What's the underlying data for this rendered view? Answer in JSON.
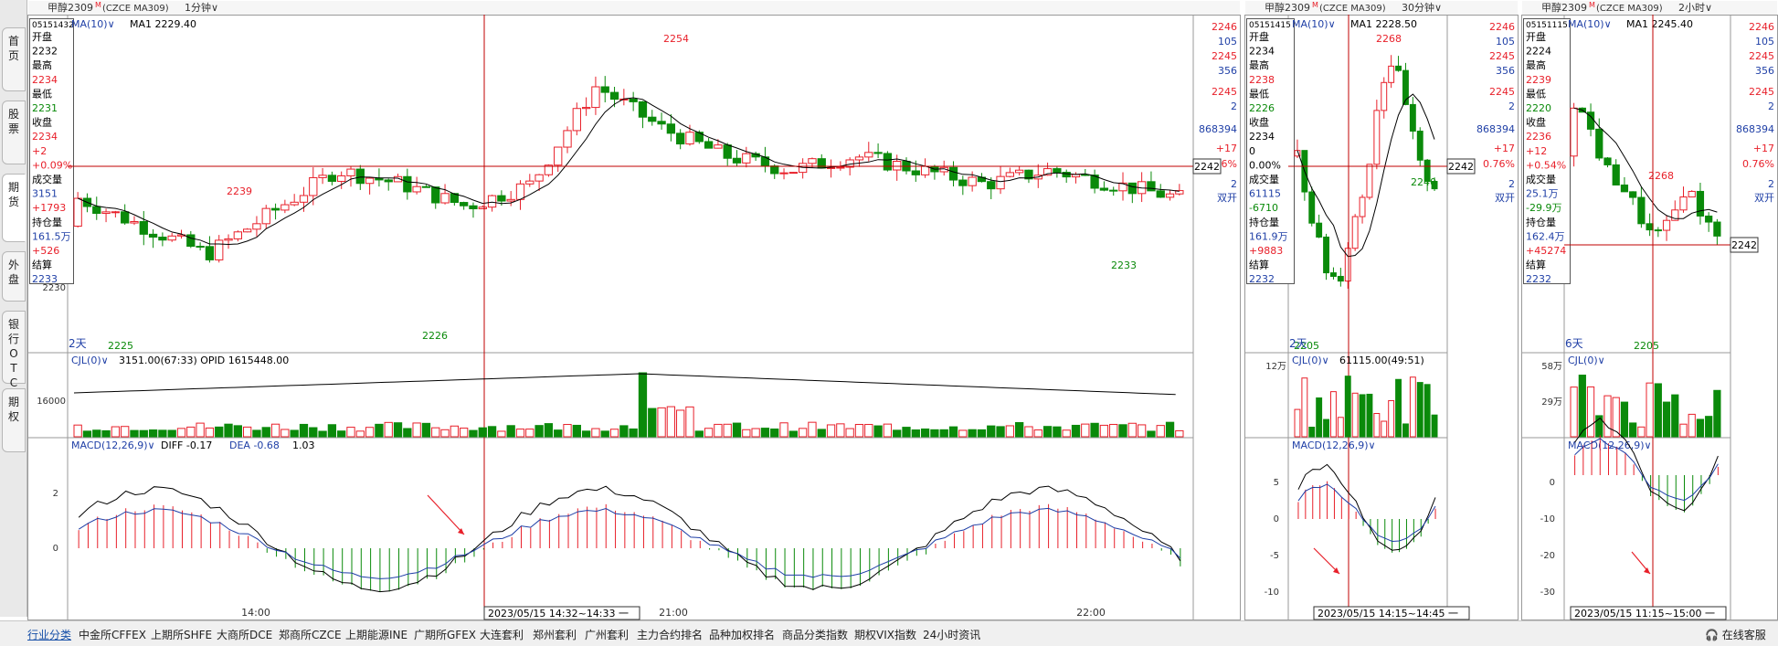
{
  "left_tabs": [
    "首页",
    "股票",
    "期货",
    "外盘",
    "银行OTC",
    "期权"
  ],
  "bottom_tabs": [
    "行业分类",
    "中金所CFFEX",
    "上期所SHFE",
    "大商所DCE",
    "郑商所CZCE",
    "上期能源INE",
    "广期所GFEX",
    "大连套利",
    "郑州套利",
    "广州套利",
    "主力合约排名",
    "品种加权排名",
    "商品分类指数",
    "期权VIX指数",
    "24小时资讯"
  ],
  "online_service": "在线客服",
  "colors": {
    "up": "#e8202a",
    "down": "#0a8a0a",
    "blue": "#1f3fa6",
    "crosshair": "#c00000"
  },
  "panels": [
    {
      "name": "min1",
      "header": {
        "title": "甲醇2309",
        "sup": "M",
        "code": "(CZCE MA309)",
        "period": "1分钟"
      },
      "ma_label": "MA(10)",
      "ma_value": "MA1 2229.40",
      "info": {
        "id": "05151432",
        "rows": [
          [
            "开盘",
            "k"
          ],
          [
            "2232",
            "v"
          ],
          [
            "最高",
            "k"
          ],
          [
            "2234",
            "r"
          ],
          [
            "最低",
            "k"
          ],
          [
            "2231",
            "g"
          ],
          [
            "收盘",
            "k"
          ],
          [
            "2234",
            "r"
          ],
          [
            "+2",
            "r"
          ],
          [
            "+0.09%",
            "r"
          ],
          [
            "成交量",
            "k"
          ],
          [
            "3151",
            "b"
          ],
          [
            "+1793",
            "r"
          ],
          [
            "持仓量",
            "k"
          ],
          [
            "161.5万",
            "b"
          ],
          [
            "+526",
            "r"
          ],
          [
            "结算",
            "k"
          ],
          [
            "2233",
            "b"
          ]
        ]
      },
      "price_axis_label": "2230",
      "days_label": "2天",
      "annotations": [
        {
          "text": "2254",
          "color": "red"
        },
        {
          "text": "2239",
          "color": "red"
        },
        {
          "text": "2225",
          "color": "green"
        },
        {
          "text": "2226",
          "color": "green"
        },
        {
          "text": "2233",
          "color": "green"
        }
      ],
      "cross_price": "2242",
      "vol_label": "CJL(0)",
      "vol_value": "3151.00(67:33)  OPID 1615448.00",
      "vol_axis": [
        "16000"
      ],
      "macd_label": "MACD(12,26,9)",
      "macd_diff": "DIFF -0.17",
      "macd_dea": "DEA -0.68",
      "macd_val": "1.03",
      "macd_axis": [
        "2",
        "0"
      ],
      "time_labels": [
        "14:00",
        "21:00",
        "22:00"
      ],
      "time_box": "2023/05/15 14:32~14:33 一",
      "right_stats": [
        [
          "2246",
          "r"
        ],
        [
          "105",
          "b"
        ],
        [
          "2245",
          "r"
        ],
        [
          "356",
          "b"
        ],
        [
          "2245",
          "r"
        ],
        [
          "2",
          "b"
        ],
        [
          "868394",
          "b"
        ],
        [
          "+17",
          "r"
        ],
        [
          "0.76%",
          "r"
        ],
        [
          "2",
          "b"
        ],
        [
          "双开",
          "b"
        ]
      ]
    },
    {
      "name": "min30",
      "header": {
        "title": "甲醇2309",
        "sup": "M",
        "code": "(CZCE MA309)",
        "period": "30分钟"
      },
      "ma_label": "MA(10)",
      "ma_value": "MA1 2228.50",
      "info": {
        "id": "05151415",
        "rows": [
          [
            "开盘",
            "k"
          ],
          [
            "2234",
            "v"
          ],
          [
            "最高",
            "k"
          ],
          [
            "2238",
            "r"
          ],
          [
            "最低",
            "k"
          ],
          [
            "2226",
            "g"
          ],
          [
            "收盘",
            "k"
          ],
          [
            "2234",
            "v"
          ],
          [
            "0",
            "v"
          ],
          [
            "0.00%",
            "v"
          ],
          [
            "成交量",
            "k"
          ],
          [
            "61115",
            "b"
          ],
          [
            "-6710",
            "g"
          ],
          [
            "持仓量",
            "k"
          ],
          [
            "161.9万",
            "b"
          ],
          [
            "+9883",
            "r"
          ],
          [
            "结算",
            "k"
          ],
          [
            "2232",
            "b"
          ]
        ]
      },
      "days_label": "2天",
      "annotations": [
        {
          "text": "2268",
          "color": "red"
        },
        {
          "text": "2240",
          "color": "green"
        },
        {
          "text": "2205",
          "color": "green"
        }
      ],
      "cross_price": "2242",
      "vol_label": "CJL(0)",
      "vol_value": "61115.00(49:51)",
      "vol_axis": [
        "12万"
      ],
      "macd_label": "MACD(12,26,9)",
      "macd_axis": [
        "5",
        "0",
        "-5",
        "-10"
      ],
      "time_box": "2023/05/15 14:15~14:45 一",
      "right_stats": [
        [
          "2246",
          "r"
        ],
        [
          "105",
          "b"
        ],
        [
          "2245",
          "r"
        ],
        [
          "356",
          "b"
        ],
        [
          "2245",
          "r"
        ],
        [
          "2",
          "b"
        ],
        [
          "868394",
          "b"
        ],
        [
          "+17",
          "r"
        ],
        [
          "0.76%",
          "r"
        ],
        [
          "2",
          "b"
        ],
        [
          "双开",
          "b"
        ]
      ]
    },
    {
      "name": "h2",
      "header": {
        "title": "甲醇2309",
        "sup": "M",
        "code": "(CZCE MA309)",
        "period": "2小时"
      },
      "ma_label": "MA(10)",
      "ma_value": "MA1 2245.40",
      "info": {
        "id": "05151115",
        "rows": [
          [
            "开盘",
            "k"
          ],
          [
            "2224",
            "v"
          ],
          [
            "最高",
            "k"
          ],
          [
            "2239",
            "r"
          ],
          [
            "最低",
            "k"
          ],
          [
            "2220",
            "g"
          ],
          [
            "收盘",
            "k"
          ],
          [
            "2236",
            "r"
          ],
          [
            "+12",
            "r"
          ],
          [
            "+0.54%",
            "r"
          ],
          [
            "成交量",
            "k"
          ],
          [
            "25.1万",
            "b"
          ],
          [
            "-29.9万",
            "g"
          ],
          [
            "持仓量",
            "k"
          ],
          [
            "162.4万",
            "b"
          ],
          [
            "+45274",
            "r"
          ],
          [
            "结算",
            "k"
          ],
          [
            "2232",
            "b"
          ]
        ]
      },
      "days_label": "6天",
      "annotations": [
        {
          "text": "2268",
          "color": "red"
        },
        {
          "text": "2205",
          "color": "green"
        }
      ],
      "cross_price": "2242",
      "vol_label": "CJL(0)",
      "vol_axis": [
        "58万",
        "29万"
      ],
      "macd_label": "MACD(12,26,9)",
      "macd_axis": [
        "0",
        "-10",
        "-20",
        "-30"
      ],
      "time_box": "2023/05/15 11:15~15:00 一",
      "right_stats": [
        [
          "2246",
          "r"
        ],
        [
          "105",
          "b"
        ],
        [
          "2245",
          "r"
        ],
        [
          "356",
          "b"
        ],
        [
          "2245",
          "r"
        ],
        [
          "2",
          "b"
        ],
        [
          "868394",
          "b"
        ],
        [
          "+17",
          "r"
        ],
        [
          "0.76%",
          "r"
        ],
        [
          "2",
          "b"
        ],
        [
          "双开",
          "b"
        ]
      ]
    }
  ]
}
